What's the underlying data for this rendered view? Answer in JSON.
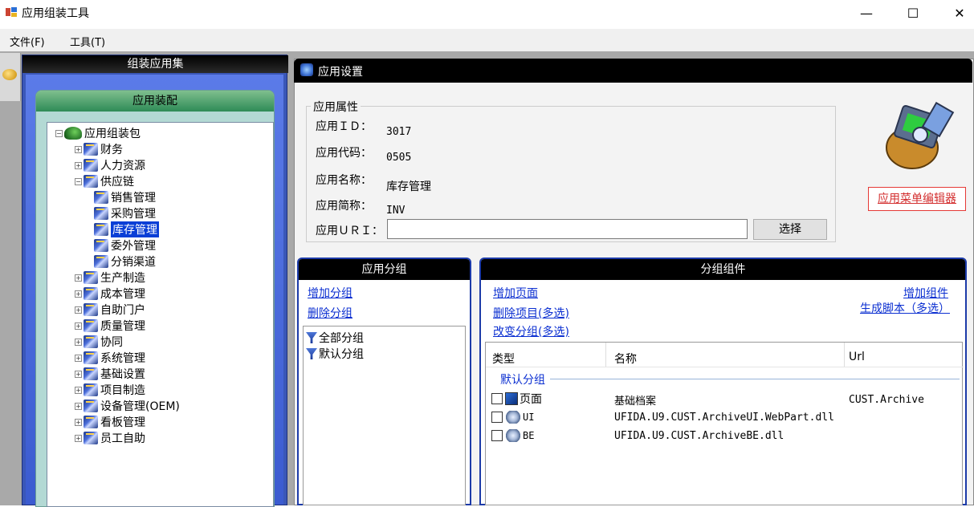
{
  "window": {
    "title": "应用组装工具",
    "minimize": "—",
    "maximize": "☐",
    "close": "✕"
  },
  "menubar": {
    "file": "文件(F)",
    "tools": "工具(T)"
  },
  "left_panel": {
    "title": "组装应用集",
    "assembly_title": "应用装配",
    "tree": {
      "root": "应用组装包",
      "items": [
        {
          "label": "财务"
        },
        {
          "label": "人力资源"
        },
        {
          "label": "供应链"
        },
        {
          "label": "销售管理"
        },
        {
          "label": "采购管理"
        },
        {
          "label": "库存管理"
        },
        {
          "label": "委外管理"
        },
        {
          "label": "分销渠道"
        },
        {
          "label": "生产制造"
        },
        {
          "label": "成本管理"
        },
        {
          "label": "自助门户"
        },
        {
          "label": "质量管理"
        },
        {
          "label": "协同"
        },
        {
          "label": "系统管理"
        },
        {
          "label": "基础设置"
        },
        {
          "label": "项目制造"
        },
        {
          "label": "设备管理(OEM)"
        },
        {
          "label": "看板管理"
        },
        {
          "label": "员工自助"
        }
      ]
    }
  },
  "settings": {
    "title": "应用设置",
    "attributes_legend": "应用属性",
    "fields": {
      "id_label": "应用ＩＤ：",
      "id_value": "3017",
      "code_label": "应用代码：",
      "code_value": "0505",
      "name_label": "应用名称：",
      "name_value": "库存管理",
      "short_label": "应用简称：",
      "short_value": "INV",
      "uri_label": "应用ＵＲＩ：",
      "uri_value": ""
    },
    "choose_button": "选择",
    "menu_editor_link": "应用菜单编辑器"
  },
  "group_panel": {
    "title": "应用分组",
    "add_link": "增加分组",
    "delete_link": "删除分组",
    "groups": [
      {
        "label": "全部分组"
      },
      {
        "label": "默认分组"
      }
    ]
  },
  "component_panel": {
    "title": "分组组件",
    "add_page_link": "增加页面",
    "delete_items_link": "删除项目(多选)",
    "change_group_link": "改变分组(多选)",
    "add_component_link": "增加组件",
    "generate_script_link": "生成脚本（多选）",
    "columns": [
      "类型",
      "名称",
      "Url"
    ],
    "group_caption": "默认分组",
    "rows": [
      {
        "type": "页面",
        "name": "基础档案",
        "url": "CUST.Archive"
      },
      {
        "type": "UI",
        "name": "UFIDA.U9.CUST.ArchiveUI.WebPart.dll",
        "url": ""
      },
      {
        "type": "BE",
        "name": "UFIDA.U9.CUST.ArchiveBE.dll",
        "url": ""
      }
    ]
  },
  "colors": {
    "title_bar_bg": "#000000",
    "link_blue": "#0b2fd1",
    "selected_bg": "#0a3fd6",
    "panel_border_blue": "#1c3aa8",
    "editor_link_red": "#d32f2f"
  }
}
